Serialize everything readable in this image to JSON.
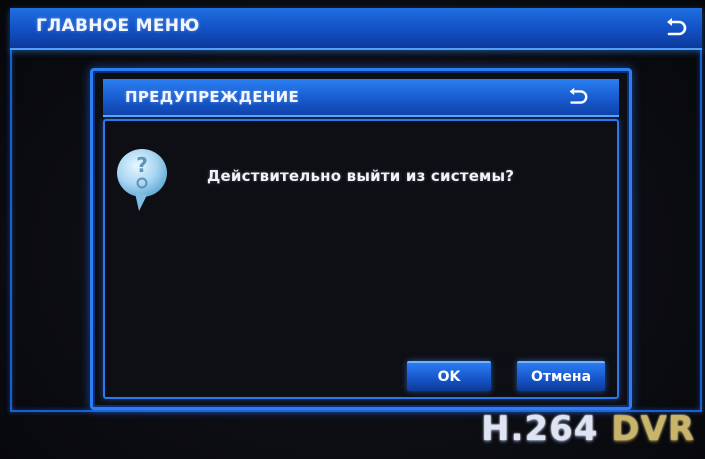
{
  "main_header": {
    "title": "ГЛАВНОЕ МЕНЮ",
    "back_icon": "back-arrow-icon"
  },
  "dialog": {
    "title": "ПРЕДУПРЕЖДЕНИЕ",
    "back_icon": "back-arrow-icon",
    "icon": "question-bubble-icon",
    "message": "Действительно выйти из системы?",
    "ok_label": "OK",
    "cancel_label": "Отмена"
  },
  "brand": {
    "codec": "H.264",
    "product": "DVR"
  },
  "colors": {
    "header_blue": "#1250c4",
    "border_blue": "#2d7ef0",
    "background": "#0c0d12",
    "brand_gold": "#c9b46a"
  }
}
